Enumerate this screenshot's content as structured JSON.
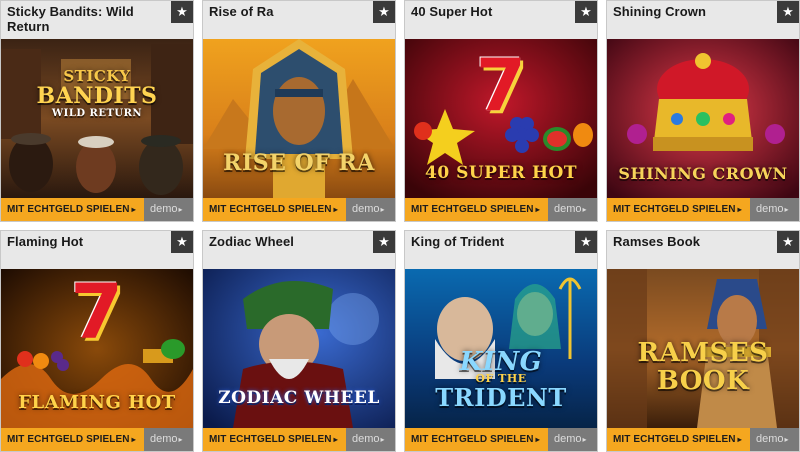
{
  "games": [
    {
      "title": "Sticky Bandits: Wild Return",
      "logo": [
        "STICKY",
        "BANDITS",
        "WILD RETURN"
      ],
      "theme": "western",
      "real_label": "MIT ECHTGELD SPIELEN",
      "demo_label": "demo",
      "arrow": "▸",
      "star": "★"
    },
    {
      "title": "Rise of Ra",
      "logo": [
        "RISE OF RA"
      ],
      "theme": "egypt-pharaoh",
      "real_label": "MIT ECHTGELD SPIELEN",
      "demo_label": "demo",
      "arrow": "▸",
      "star": "★"
    },
    {
      "title": "40 Super Hot",
      "logo": [
        "7",
        "40 SUPER HOT"
      ],
      "theme": "fruits-red",
      "real_label": "MIT ECHTGELD SPIELEN",
      "demo_label": "demo",
      "arrow": "▸",
      "star": "★"
    },
    {
      "title": "Shining Crown",
      "logo": [
        "SHINING CROWN"
      ],
      "theme": "crown",
      "real_label": "MIT ECHTGELD SPIELEN",
      "demo_label": "demo",
      "arrow": "▸",
      "star": "★"
    },
    {
      "title": "Flaming Hot",
      "logo": [
        "7",
        "FLAMING HOT"
      ],
      "theme": "fruits-fire",
      "real_label": "MIT ECHTGELD SPIELEN",
      "demo_label": "demo",
      "arrow": "▸",
      "star": "★"
    },
    {
      "title": "Zodiac Wheel",
      "logo": [
        "ZODIAC WHEEL"
      ],
      "theme": "wizard",
      "real_label": "MIT ECHTGELD SPIELEN",
      "demo_label": "demo",
      "arrow": "▸",
      "star": "★"
    },
    {
      "title": "King of Trident",
      "logo": [
        "KING",
        "OF THE",
        "TRIDENT"
      ],
      "theme": "ocean",
      "real_label": "MIT ECHTGELD SPIELEN",
      "demo_label": "demo",
      "arrow": "▸",
      "star": "★"
    },
    {
      "title": "Ramses Book",
      "logo": [
        "RAMSES",
        "BOOK"
      ],
      "theme": "egypt-book",
      "real_label": "MIT ECHTGELD SPIELEN",
      "demo_label": "demo",
      "arrow": "▸",
      "star": "★"
    }
  ],
  "colors": {
    "real_button": "#f5a71f",
    "demo_button": "#7a7a7a",
    "header_bg": "#e8e8e8",
    "star_bg": "#3a3a3a"
  }
}
